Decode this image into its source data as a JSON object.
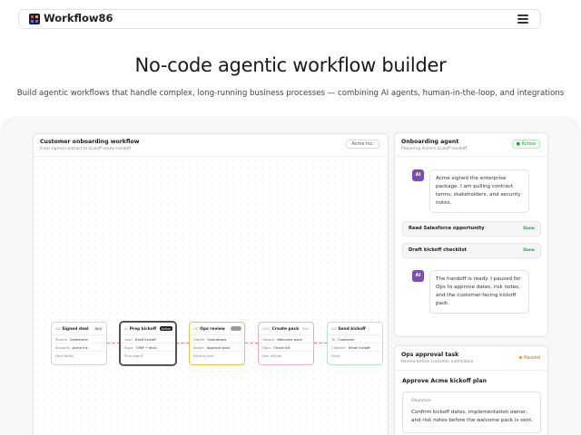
{
  "nav": {
    "brand": "Workflow86",
    "logo_colors": [
      "#e0523f",
      "#f2a93b",
      "#4a7be0",
      "#8f56c9"
    ]
  },
  "hero": {
    "title": "No-code agentic workflow builder",
    "subtitle": "Build agentic workflows that handle complex, long-running business processes — combining AI agents, human-in-the-loop, and integrations"
  },
  "workflow": {
    "title": "Customer onboarding workflow",
    "subtitle": "From signed contract to kickoff-ready handoff",
    "tag": "Acme Inc.",
    "nodes": [
      {
        "code": "SD",
        "name": "Signed deal",
        "status": "New",
        "rows": [
          [
            "Source",
            "Salesforce"
          ],
          [
            "Account",
            "Acme Inc."
          ]
        ],
        "footer": "Deal fields",
        "border": "#d6d6d6",
        "status_bg": "#f0f0f0",
        "status_color": "#555"
      },
      {
        "code": "AI",
        "name": "Prep kickoff",
        "status": "Active",
        "rows": [
          [
            "Goal",
            "Draft kickoff"
          ],
          [
            "Input",
            "CRM + docs"
          ]
        ],
        "footer": "Plan agent",
        "border": "#555555",
        "status_bg": "#222222",
        "status_color": "#ffffff"
      },
      {
        "code": "OP",
        "name": "Ops review",
        "status": "",
        "rows": [
          [
            "Owner",
            "Operations"
          ],
          [
            "Action",
            "Approve plan"
          ]
        ],
        "footer": "Review task",
        "border": "#e7c54b",
        "status_bg": "#9a9a9a",
        "status_color": "#ffffff"
      },
      {
        "code": "DOC",
        "name": "Create pack",
        "status": "Run",
        "rows": [
          [
            "Output",
            "Welcome pack"
          ],
          [
            "Docs",
            "Check list"
          ]
        ],
        "footer": "Doc builder",
        "border": "#e4b6c4",
        "status_bg": "#ffffff",
        "status_color": "#999"
      },
      {
        "code": "SD",
        "name": "Send kickoff",
        "status": "",
        "rows": [
          [
            "To",
            "Customer"
          ],
          [
            "Channel",
            "Email kickoff"
          ]
        ],
        "footer": "Send",
        "border": "#bfe3cf",
        "status_bg": "#ffffff",
        "status_color": "#999"
      }
    ]
  },
  "agent": {
    "title": "Onboarding agent",
    "subtitle": "Preparing Acme's kickoff handoff",
    "status": "Active",
    "avatar": "AI",
    "message_1": "Acme signed the enterprise package. I am pulling contract terms, stakeholders, and security notes.",
    "tasks": [
      {
        "label": "Read Salesforce opportunity",
        "state": "Done"
      },
      {
        "label": "Draft kickoff checklist",
        "state": "Done"
      }
    ],
    "message_2": "The handoff is ready. I paused for Ops to approve dates, risk notes, and the customer-facing kickoff pack."
  },
  "ops": {
    "title": "Ops approval task",
    "subtitle": "Review before customer notification",
    "status": "Paused",
    "heading": "Approve Acme kickoff plan",
    "objective_label": "Objective",
    "objective_text": "Confirm kickoff dates, implementation owner, and risk notes before the welcome pack is sent."
  }
}
